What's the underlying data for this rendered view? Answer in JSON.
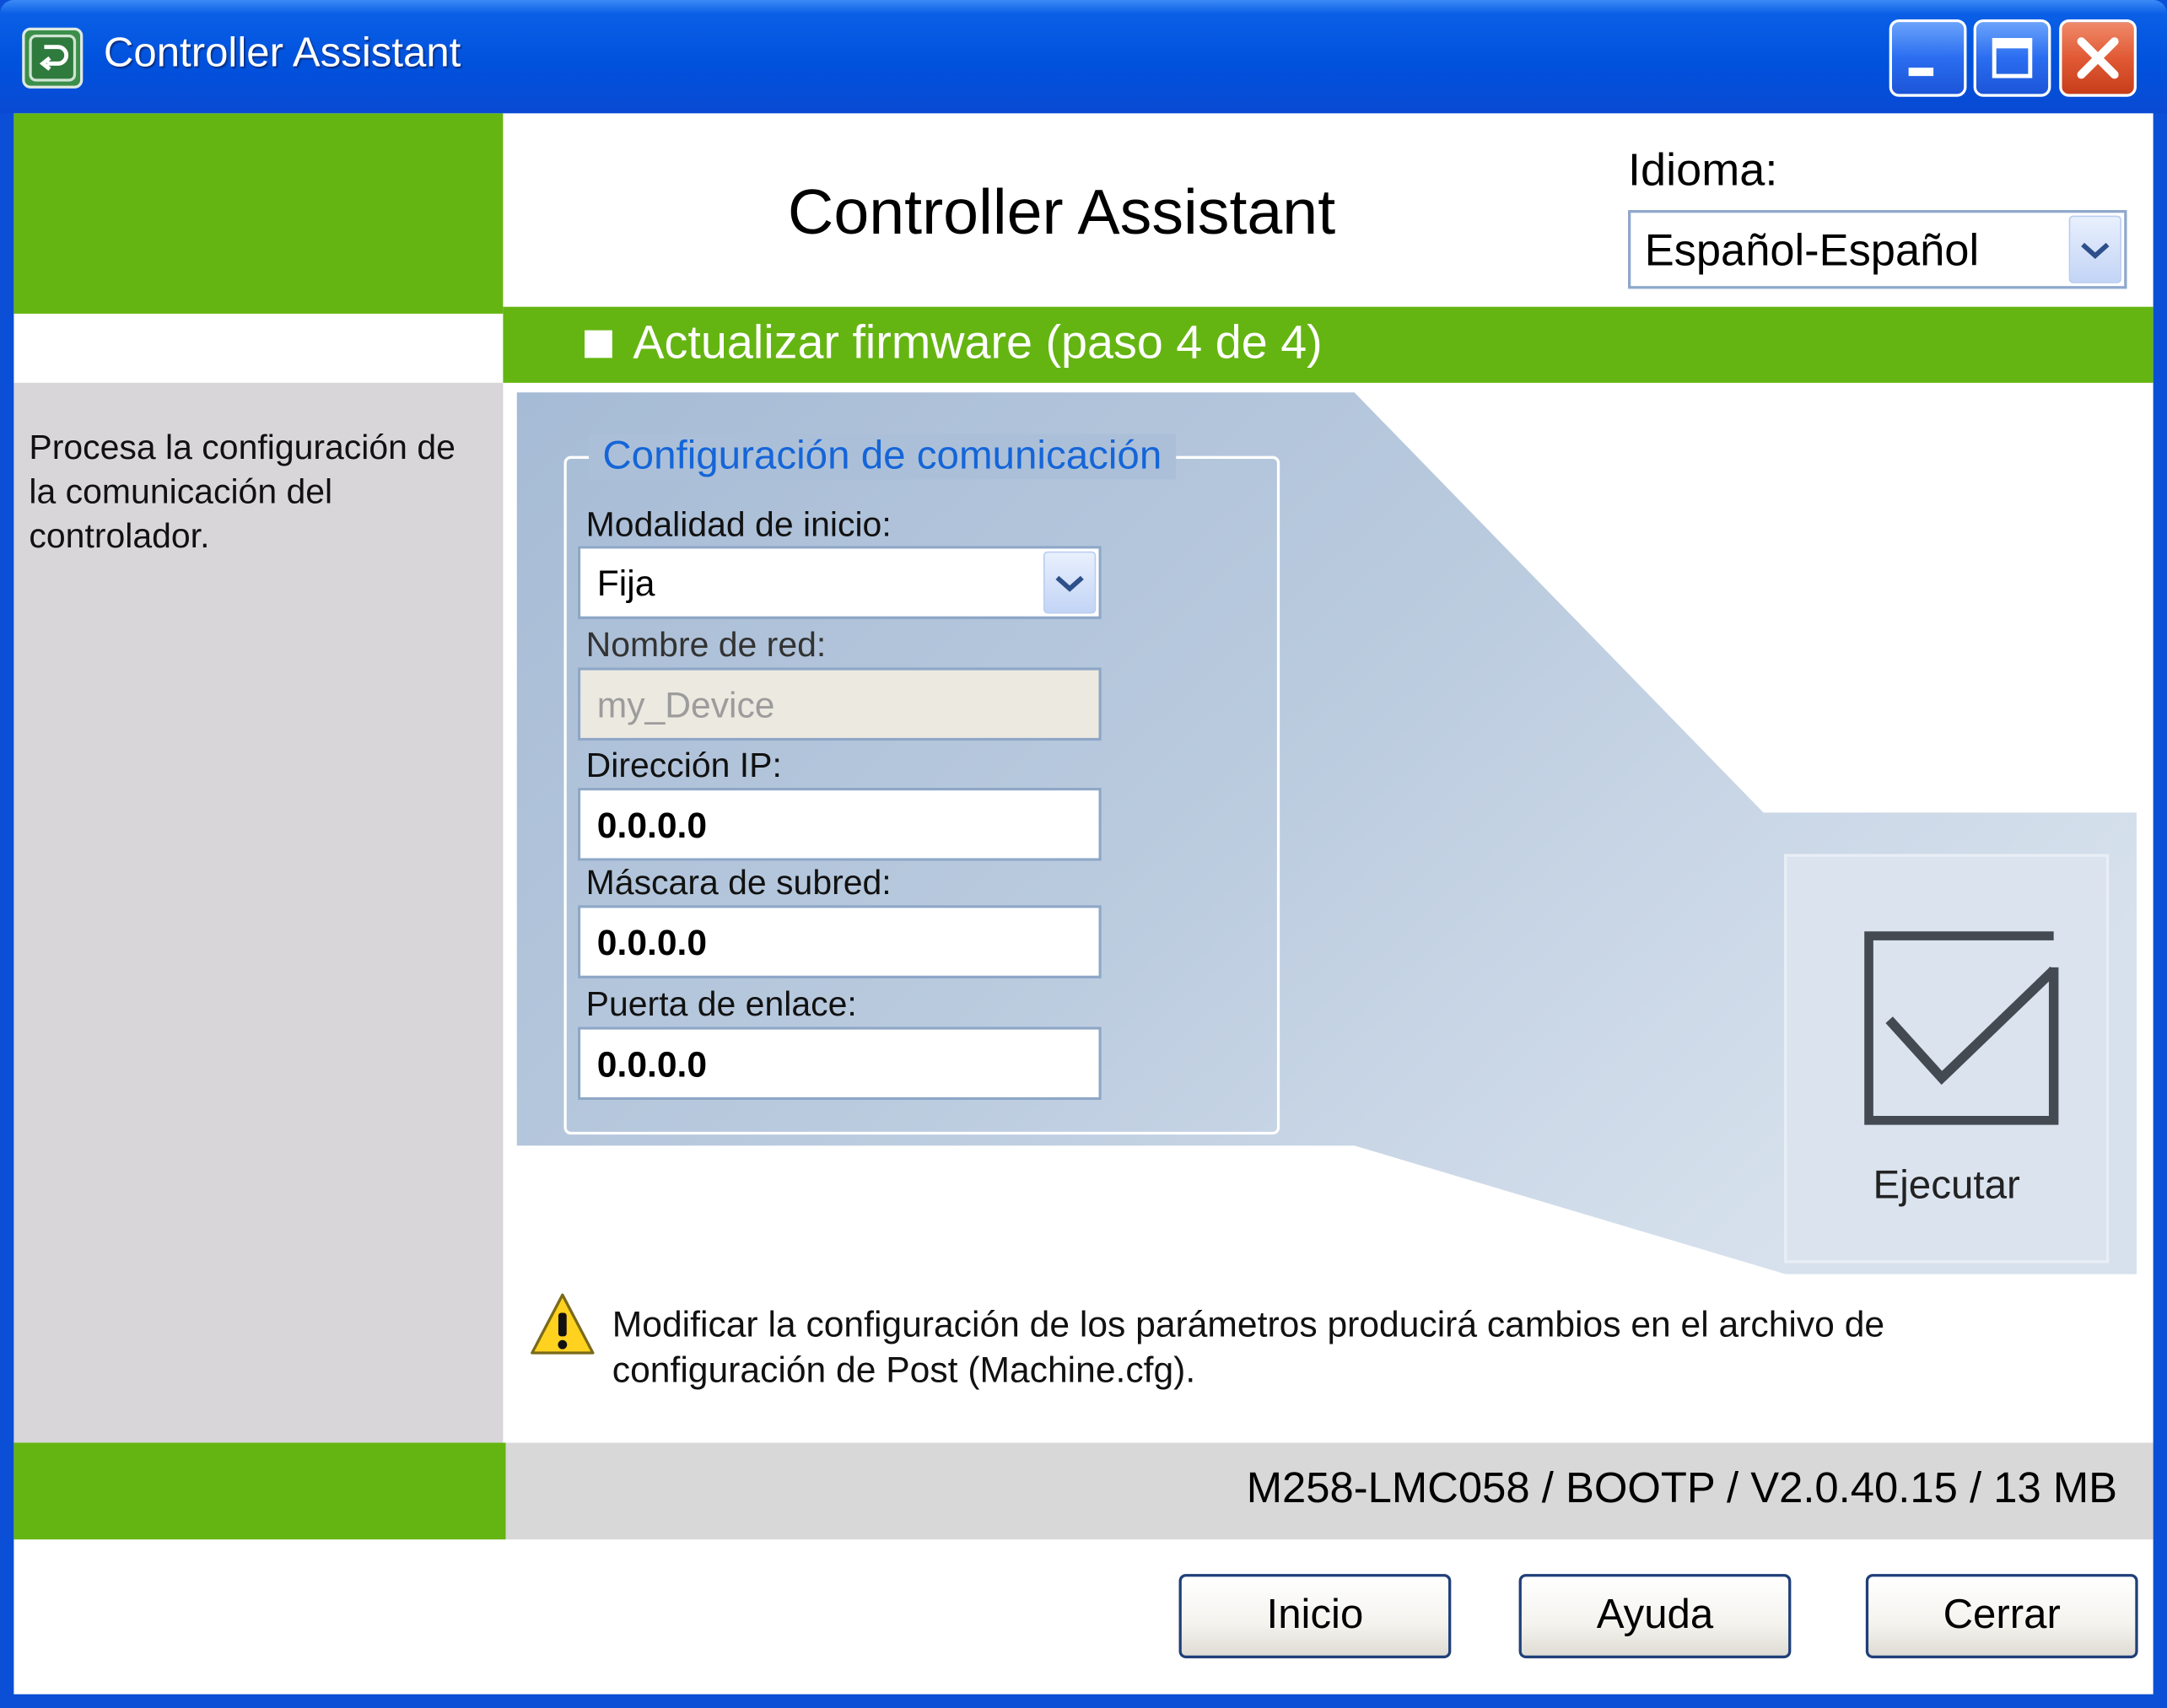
{
  "window": {
    "title": "Controller Assistant",
    "icons": {
      "app": "controller-assistant-app-icon",
      "minimize": "minimize-icon",
      "maximize": "maximize-icon",
      "close": "close-icon"
    }
  },
  "header": {
    "title": "Controller Assistant",
    "language_label": "Idioma:",
    "language_value": "Español-Español"
  },
  "step": {
    "title": "Actualizar firmware (paso 4 de 4)"
  },
  "sidebar": {
    "description": "Procesa la configuración de la comunicación del controlador."
  },
  "comm_config": {
    "legend": "Configuración de comunicación",
    "start_mode_label": "Modalidad de inicio:",
    "start_mode_value": "Fija",
    "network_name_label": "Nombre de red:",
    "network_name_value": "my_Device",
    "ip_label": "Dirección IP:",
    "ip_value": "0.0.0.0",
    "subnet_label": "Máscara de subred:",
    "subnet_value": "0.0.0.0",
    "gateway_label": "Puerta de enlace:",
    "gateway_value": "0.0.0.0"
  },
  "execute": {
    "label": "Ejecutar",
    "icon": "checkbox-checked-icon"
  },
  "warning": {
    "icon": "warning-icon",
    "text": "Modificar la configuración de los parámetros producirá cambios en el archivo de configuración de Post (Machine.cfg)."
  },
  "status": {
    "text": "M258-LMC058 / BOOTP / V2.0.40.15 / 13 MB"
  },
  "buttons": {
    "start": "Inicio",
    "help": "Ayuda",
    "close": "Cerrar"
  },
  "colors": {
    "title_bar": "#0052dd",
    "brand_green": "#65b512",
    "panel_blue": "#abc0d8",
    "sidebar_gray": "#d8d6d9",
    "legend_blue": "#1565d8"
  }
}
